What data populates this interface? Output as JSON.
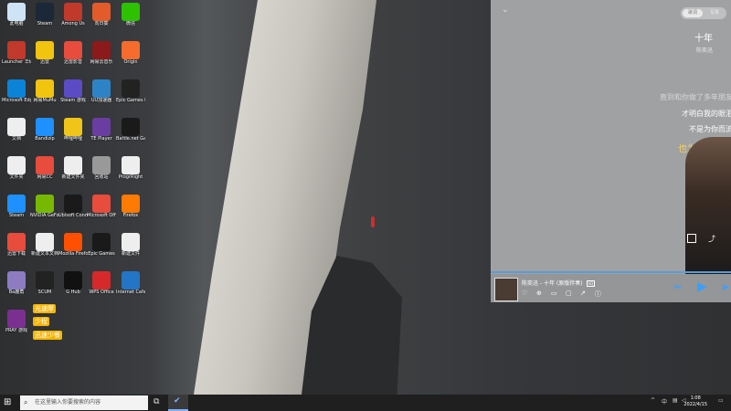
{
  "desktop_icons": [
    {
      "label": "此电脑",
      "color": "#cfe3f7"
    },
    {
      "label": "Steam",
      "color": "#1b2838"
    },
    {
      "label": "Among Us",
      "color": "#c0392b"
    },
    {
      "label": "向日葵",
      "color": "#e35b2b"
    },
    {
      "label": "微信",
      "color": "#2dc100"
    },
    {
      "label": "Launcher 华硕官方",
      "color": "#c0392b"
    },
    {
      "label": "迅雷",
      "color": "#f1c40f"
    },
    {
      "label": "迅雷影音",
      "color": "#e74c3c"
    },
    {
      "label": "网易云音乐",
      "color": "#8b1a1a"
    },
    {
      "label": "Origin",
      "color": "#f56c2d"
    },
    {
      "label": "Microsoft Edge",
      "color": "#0b84d8"
    },
    {
      "label": "网易MuMu",
      "color": "#f1c40f"
    },
    {
      "label": "Steam 游戏",
      "color": "#5b4bc4"
    },
    {
      "label": "UU加速器",
      "color": "#2c84c6"
    },
    {
      "label": "Epic Games Launcher",
      "color": "#222"
    },
    {
      "label": "文档",
      "color": "#eee"
    },
    {
      "label": "Bandizip",
      "color": "#1e90ff"
    },
    {
      "label": "哔哩哔哩",
      "color": "#f0c419"
    },
    {
      "label": "TE Player",
      "color": "#6a3ea1"
    },
    {
      "label": "Battle.net Games",
      "color": "#1a1a1a"
    },
    {
      "label": "文件夹",
      "color": "#eee"
    },
    {
      "label": "网易CC",
      "color": "#e74c3c"
    },
    {
      "label": "新建文件夹",
      "color": "#eee"
    },
    {
      "label": "回收站",
      "color": "#999"
    },
    {
      "label": "ProgrRight",
      "color": "#eee"
    },
    {
      "label": "Steam",
      "color": "#1e90ff"
    },
    {
      "label": "NVIDIA GeForce",
      "color": "#76b900"
    },
    {
      "label": "Ubisoft Connect",
      "color": "#1a1a1a"
    },
    {
      "label": "Microsoft Office Hub",
      "color": "#e74c3c"
    },
    {
      "label": "Firefox",
      "color": "#ff7a00"
    },
    {
      "label": "迅雷下载",
      "color": "#e74c3c"
    },
    {
      "label": "新建文本文档",
      "color": "#eee"
    },
    {
      "label": "Mozilla Firefox",
      "color": "#ff4f00"
    },
    {
      "label": "Epic Games",
      "color": "#1a1a1a"
    },
    {
      "label": "新建文件",
      "color": "#eee"
    },
    {
      "label": "Ba鹿角",
      "color": "#8e7cc3"
    },
    {
      "label": "SCUM",
      "color": "#222"
    },
    {
      "label": "G Hub",
      "color": "#111"
    },
    {
      "label": "WPS Office",
      "color": "#d62a2a"
    },
    {
      "label": "Internet Cafe",
      "color": "#2475c6"
    },
    {
      "label": "PRAY 游戏",
      "color": "#7b2f90"
    }
  ],
  "stickers": [
    "光速摩",
    "少程",
    "迅速少餐"
  ],
  "music_panel": {
    "toggle_on": "歌词",
    "toggle_off": "写真",
    "song_title": "十年",
    "singer": "陈奕迅",
    "lyrics": [
      "直到和你做了多年朋友",
      "才明白我的眼泪",
      "不是为你而流",
      "也为别人而流"
    ],
    "player_title": "陈奕迅 - 十年 (原版伴奏)",
    "quality_badge": "SQ"
  },
  "taskbar": {
    "search_placeholder": "在这里输入你要搜索的内容",
    "ime": "中",
    "time": "1:08",
    "date": "2022/4/15"
  }
}
